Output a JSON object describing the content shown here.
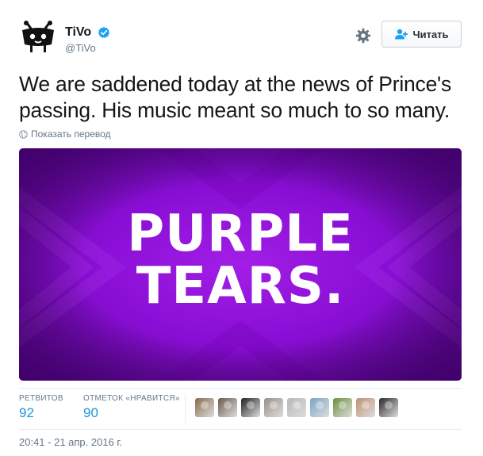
{
  "author": {
    "display_name": "TiVo",
    "handle": "@TiVo",
    "verified": true,
    "avatar_icon": "tivo-logo-icon"
  },
  "header": {
    "follow_label": "Читать",
    "follow_icon": "add-user-icon",
    "settings_icon": "gear-icon"
  },
  "tweet": {
    "text": "We are saddened today at the news of Prince's passing. His music meant so much to so many.",
    "translate_label": "Показать перевод",
    "translate_icon": "globe-icon"
  },
  "media": {
    "line1": "PURPLE",
    "line2": "TEARS.",
    "background_color": "#8a0fd6"
  },
  "stats": {
    "retweets_label": "РЕТВИТОВ",
    "retweets_count": "92",
    "likes_label": "ОТМЕТОК «НРАВИТСЯ»",
    "likes_count": "90"
  },
  "liked_by": [
    {
      "name": "liker-avatar-1",
      "color": "#8a6a4a"
    },
    {
      "name": "liker-avatar-2",
      "color": "#6b5a4e"
    },
    {
      "name": "liker-avatar-3",
      "color": "#222222"
    },
    {
      "name": "liker-avatar-4",
      "color": "#9a8f86"
    },
    {
      "name": "liker-avatar-5",
      "color": "#b8b8b8"
    },
    {
      "name": "liker-avatar-6",
      "color": "#7aa4c8"
    },
    {
      "name": "liker-avatar-7",
      "color": "#6f8f3a"
    },
    {
      "name": "liker-avatar-8",
      "color": "#c09070"
    },
    {
      "name": "liker-avatar-9",
      "color": "#2a2a2a"
    }
  ],
  "timestamp": "20:41 - 21 апр. 2016 г.",
  "colors": {
    "link_blue": "#1b95e0",
    "verified_blue": "#1da1f2",
    "muted_gray": "#657786"
  }
}
